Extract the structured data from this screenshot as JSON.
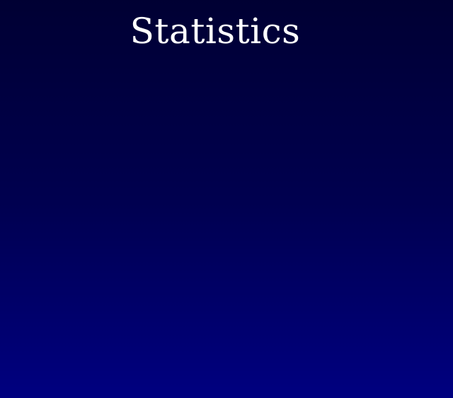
{
  "page": {
    "title": "Statistics"
  },
  "colors": {
    "background_top": "#000033",
    "background_bottom": "#000080",
    "title_text": "#ffffff"
  }
}
